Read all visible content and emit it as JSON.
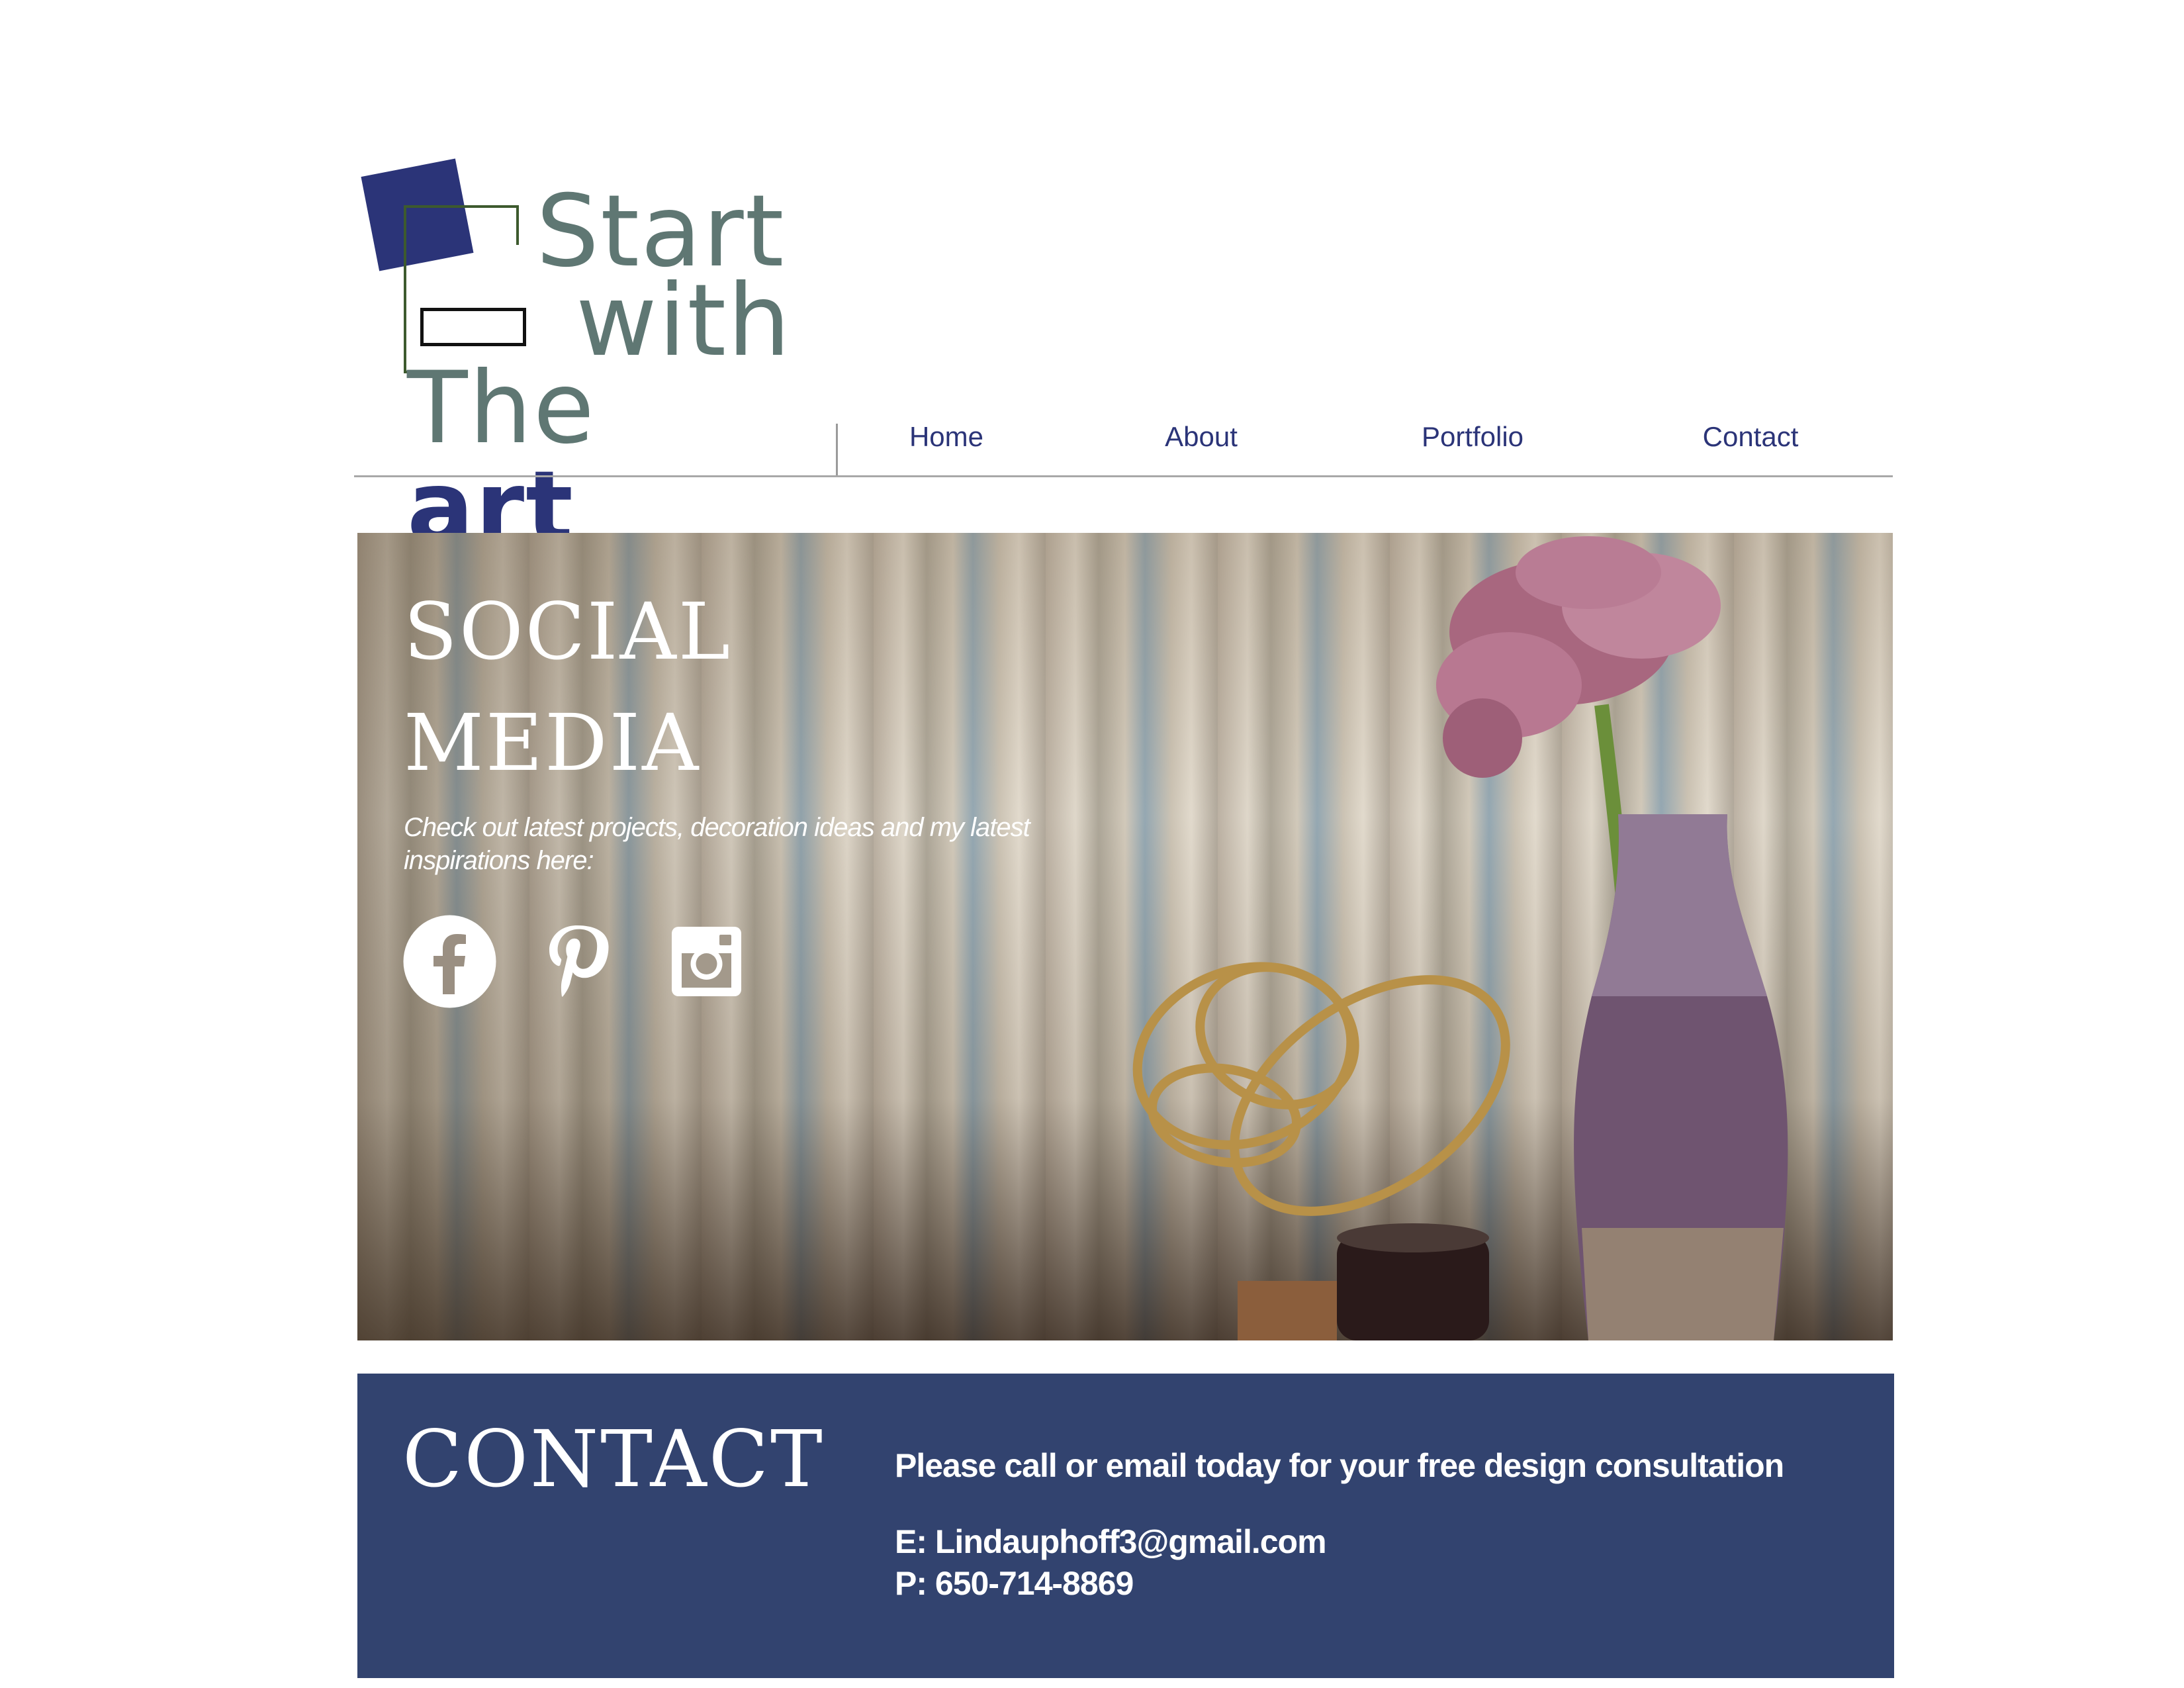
{
  "logo": {
    "line1": "Start",
    "line2": "with",
    "line3_a": "The",
    "line3_b": "art"
  },
  "nav": {
    "items": [
      {
        "label": "Home"
      },
      {
        "label": "About"
      },
      {
        "label": "Portfolio"
      },
      {
        "label": "Contact"
      }
    ]
  },
  "hero": {
    "title_line1": "SOCIAL",
    "title_line2": "MEDIA",
    "subtitle": "Check out latest projects, decoration ideas and my latest inspirations here:",
    "social_icons": [
      "facebook-icon",
      "pinterest-icon",
      "instagram-icon"
    ]
  },
  "contact": {
    "title": "CONTACT",
    "message": "Please call or email today for your free design consultation",
    "email": "E: Lindauphoff3@gmail.com",
    "phone": "P: 650-714-8869"
  },
  "colors": {
    "brand_navy": "#2b3478",
    "logo_gray": "#5f7773",
    "contact_bg": "#32436f",
    "nav_text": "#2b3478"
  }
}
